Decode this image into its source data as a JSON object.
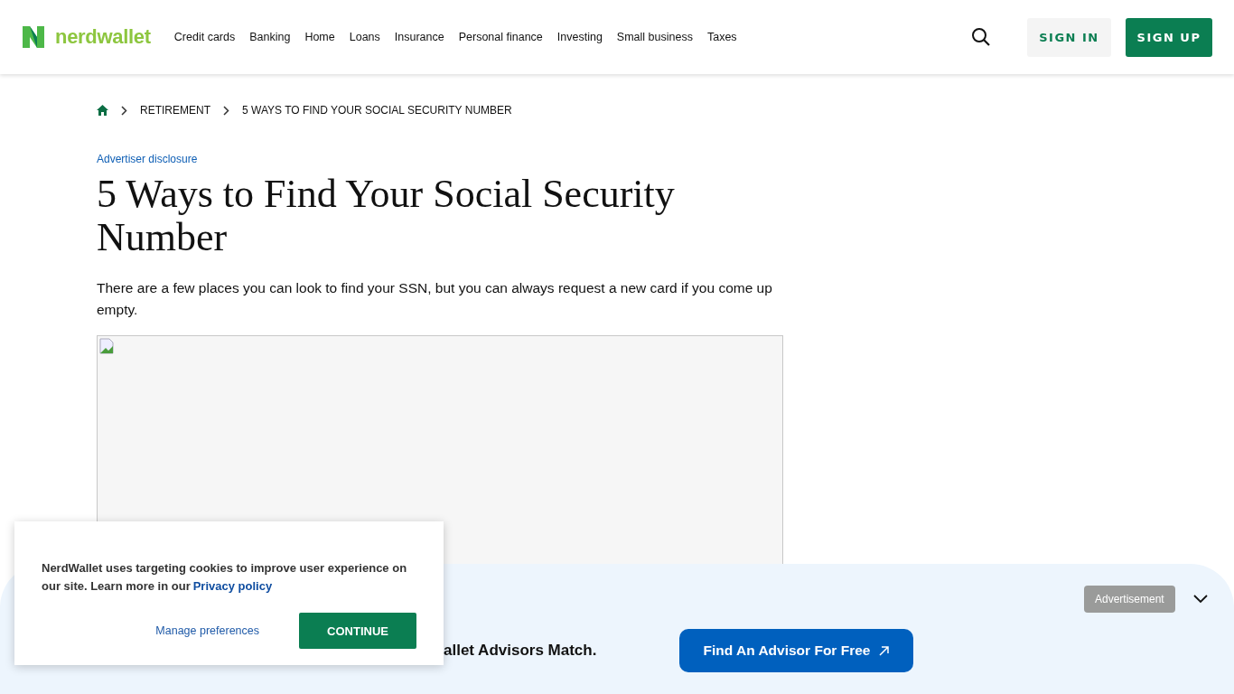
{
  "header": {
    "logo": "nerdwallet",
    "nav": [
      "Credit cards",
      "Banking",
      "Home",
      "Loans",
      "Insurance",
      "Personal finance",
      "Investing",
      "Small business",
      "Taxes"
    ],
    "sign_in": "SIGN IN",
    "sign_up": "SIGN UP"
  },
  "breadcrumb": [
    "RETIREMENT",
    "5 WAYS TO FIND YOUR SOCIAL SECURITY NUMBER"
  ],
  "article": {
    "disclosure": "Advertiser disclosure",
    "title": "5 Ways to Find Your Social Security Number",
    "summary": "There are a few places you can look to find your SSN, but you can always request a new card if you come up empty.",
    "image": {
      "kind": "broken"
    }
  },
  "ad_banner": {
    "label": "Advertisement",
    "text": "allet Advisors Match.",
    "button": "Find An Advisor For Free"
  },
  "cookie_notice": {
    "text": "NerdWallet uses targeting cookies to improve user experience on our site. Learn more in our",
    "link": "Privacy policy",
    "manage": "Manage preferences",
    "continue": "CONTINUE"
  }
}
